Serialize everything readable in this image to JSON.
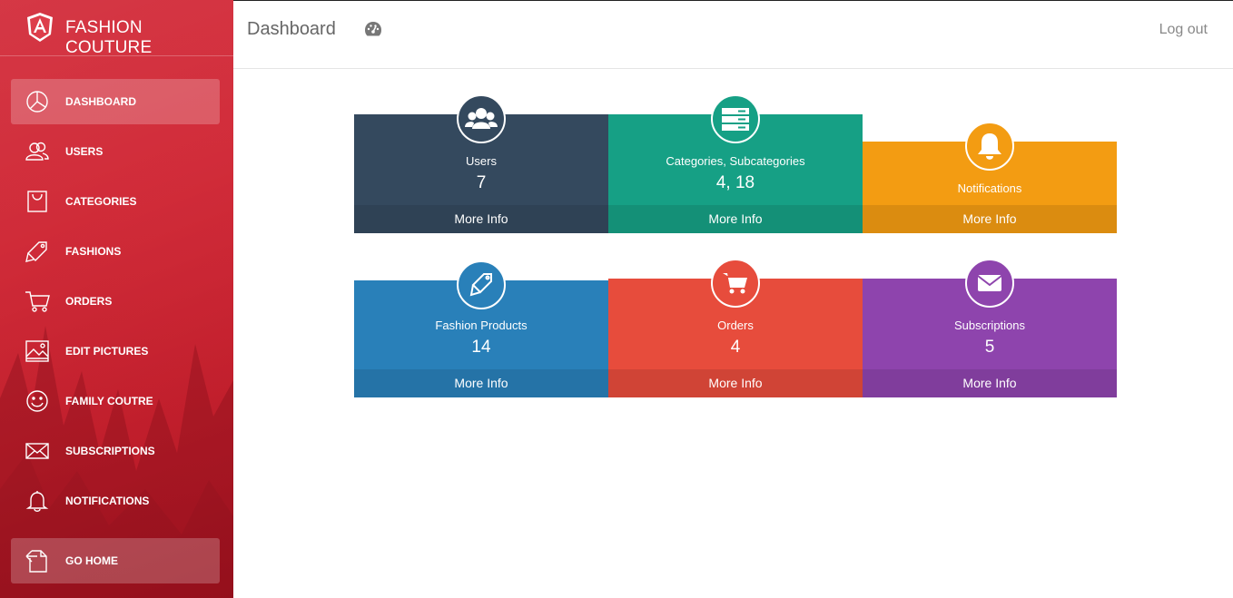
{
  "brand": {
    "title": "FASHION COUTURE"
  },
  "sidebar": {
    "items": [
      {
        "label": "DASHBOARD",
        "icon": "pie-chart-icon"
      },
      {
        "label": "USERS",
        "icon": "users-icon"
      },
      {
        "label": "CATEGORIES",
        "icon": "bag-icon"
      },
      {
        "label": "FASHIONS",
        "icon": "tag-icon"
      },
      {
        "label": "ORDERS",
        "icon": "cart-icon"
      },
      {
        "label": "EDIT PICTURES",
        "icon": "picture-icon"
      },
      {
        "label": "FAMILY COUTRE",
        "icon": "smiley-icon"
      },
      {
        "label": "SUBSCRIPTIONS",
        "icon": "envelope-icon"
      },
      {
        "label": "NOTIFICATIONS",
        "icon": "bell-icon"
      }
    ],
    "home": {
      "label": "GO HOME",
      "icon": "go-home-icon"
    }
  },
  "header": {
    "title": "Dashboard",
    "logout": "Log out"
  },
  "cards": [
    {
      "label": "Users",
      "value": "7",
      "more": "More Info",
      "color": "#34495e",
      "footer": "#2f4255",
      "icon": "users-icon"
    },
    {
      "label": "Categories, Subcategories",
      "value": "4, 18",
      "more": "More Info",
      "color": "#16a085",
      "footer": "#149077",
      "icon": "server-icon"
    },
    {
      "label": "Notifications",
      "value": "",
      "more": "More Info",
      "color": "#f39c12",
      "footer": "#db8c10",
      "icon": "bell-icon"
    },
    {
      "label": "Fashion Products",
      "value": "14",
      "more": "More Info",
      "color": "#2980b9",
      "footer": "#2573a7",
      "icon": "tag-icon"
    },
    {
      "label": "Orders",
      "value": "4",
      "more": "More Info",
      "color": "#e74c3c",
      "footer": "#d04436",
      "icon": "cart-icon"
    },
    {
      "label": "Subscriptions",
      "value": "5",
      "more": "More Info",
      "color": "#8e44ad",
      "footer": "#803d9c",
      "icon": "envelope-icon"
    }
  ]
}
